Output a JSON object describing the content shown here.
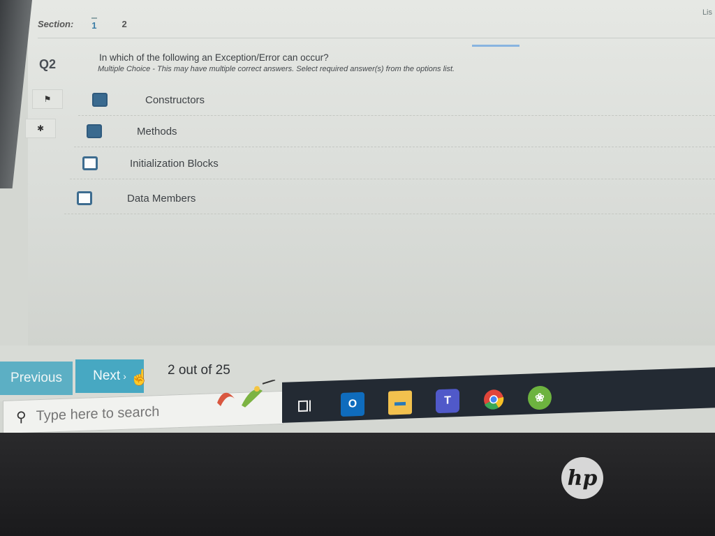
{
  "header": {
    "corner_text": "Lis",
    "section_label": "Section:",
    "sections": [
      "1",
      "2"
    ],
    "active_section": "1"
  },
  "question": {
    "number": "Q2",
    "text": "In which of the following an Exception/Error can occur?",
    "type_hint": "Multiple Choice - This may have multiple correct answers. Select required answer(s) from the options list.",
    "options": [
      {
        "label": "Constructors",
        "checked": true
      },
      {
        "label": "Methods",
        "checked": true
      },
      {
        "label": "Initialization Blocks",
        "checked": false
      },
      {
        "label": "Data Members",
        "checked": false
      }
    ]
  },
  "tools": {
    "flag_icon": "flag-icon",
    "bug_icon": "bug-icon"
  },
  "navigation": {
    "previous_label": "Previous",
    "next_label": "Next",
    "page_status": "2 out of 25"
  },
  "taskbar": {
    "search_placeholder": "Type here to search",
    "icons": [
      "task-view-icon",
      "outlook-icon",
      "file-explorer-icon",
      "teams-icon",
      "chrome-icon",
      "spring-tool-icon"
    ]
  },
  "device": {
    "brand": "hp"
  },
  "colors": {
    "accent": "#47a8c2",
    "checkbox": "#3a6a8f"
  }
}
